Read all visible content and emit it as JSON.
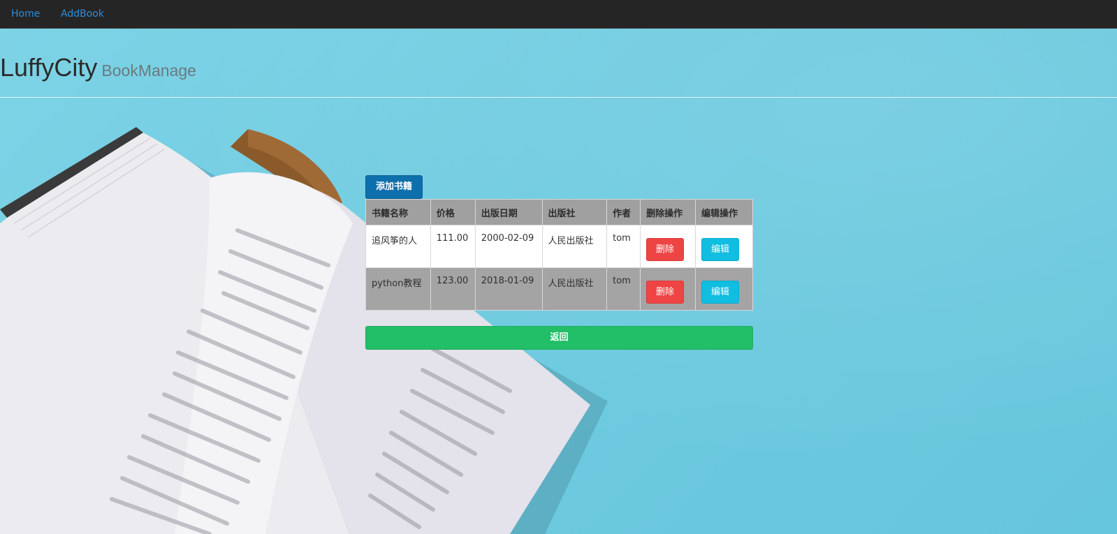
{
  "nav": {
    "home_label": "Home",
    "addbook_label": "AddBook"
  },
  "header": {
    "brand": "LuffyCity",
    "subtitle": "BookManage"
  },
  "actions": {
    "add_label": "添加书籍",
    "back_label": "返回"
  },
  "table": {
    "columns": [
      "书籍名称",
      "价格",
      "出版日期",
      "出版社",
      "作者",
      "删除操作",
      "编辑操作"
    ],
    "rows": [
      {
        "title": "追风筝的人",
        "price": "111.00",
        "date": "2000-02-09",
        "publisher": "人民出版社",
        "author": "tom",
        "delete_label": "删除",
        "edit_label": "编辑"
      },
      {
        "title": "python教程",
        "price": "123.00",
        "date": "2018-01-09",
        "publisher": "人民出版社",
        "author": "tom",
        "delete_label": "删除",
        "edit_label": "编辑"
      }
    ]
  },
  "colors": {
    "navbar": "#252525",
    "link": "#2a8fdb",
    "add_button": "#0d6fab",
    "delete_button": "#ef4444",
    "edit_button": "#11bde0",
    "back_button": "#23be68",
    "background": "#6fcbe0"
  }
}
